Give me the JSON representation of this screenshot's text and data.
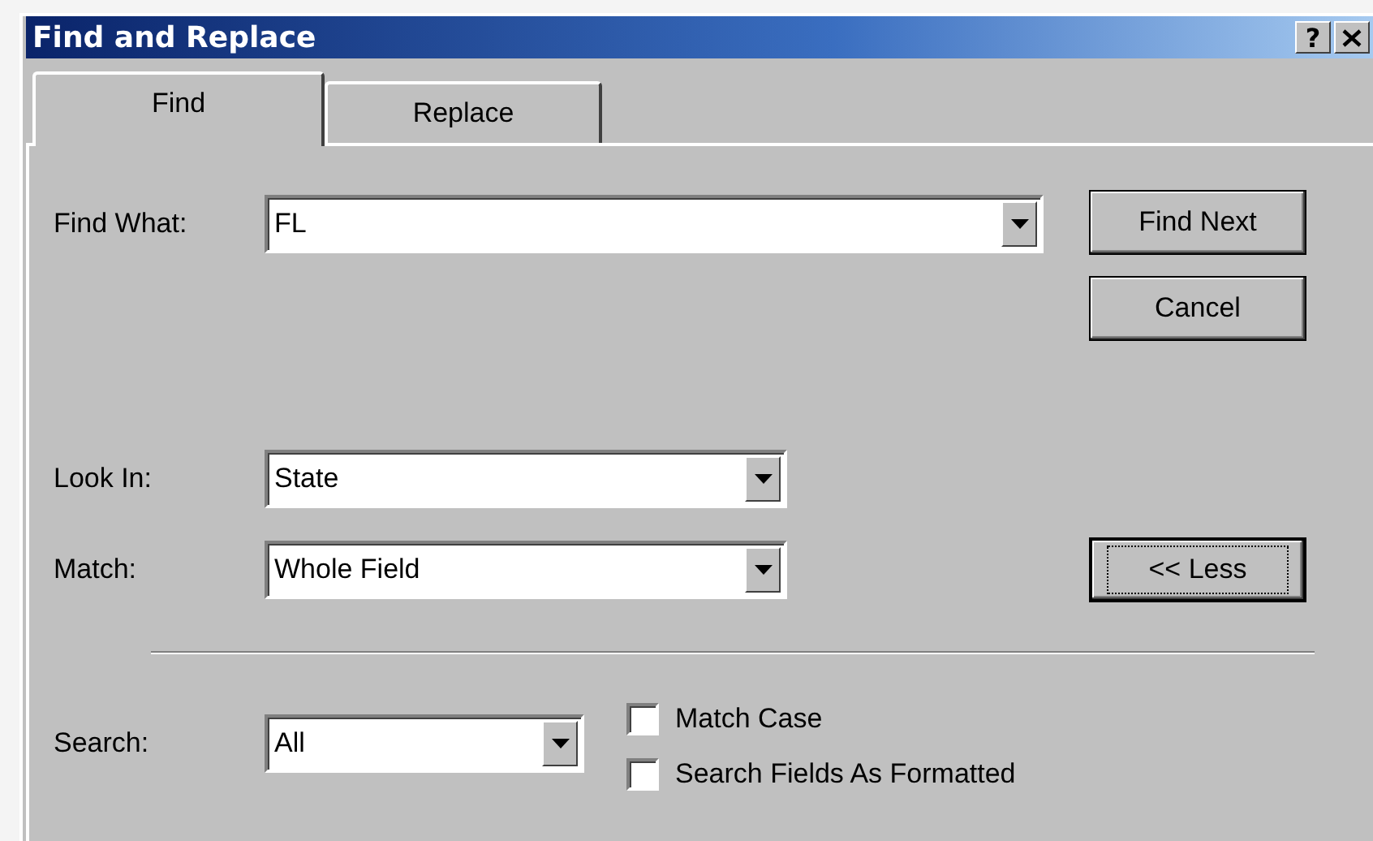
{
  "window": {
    "title": "Find and Replace",
    "help": "?"
  },
  "tabs": [
    {
      "label": "Find",
      "selected": true
    },
    {
      "label": "Replace",
      "selected": false
    }
  ],
  "find_what": {
    "label": "Find What:",
    "value": "FL"
  },
  "look_in": {
    "label": "Look In:",
    "value": "State"
  },
  "match": {
    "label": "Match:",
    "value": "Whole Field"
  },
  "search": {
    "label": "Search:",
    "value": "All"
  },
  "buttons": [
    {
      "label": "Find Next",
      "focused": false
    },
    {
      "label": "Cancel",
      "focused": false
    },
    {
      "label": "<< Less",
      "focused": true
    }
  ],
  "checkboxes": [
    {
      "label": "Match Case",
      "checked": false
    },
    {
      "label": "Search Fields As Formatted",
      "checked": false
    }
  ]
}
